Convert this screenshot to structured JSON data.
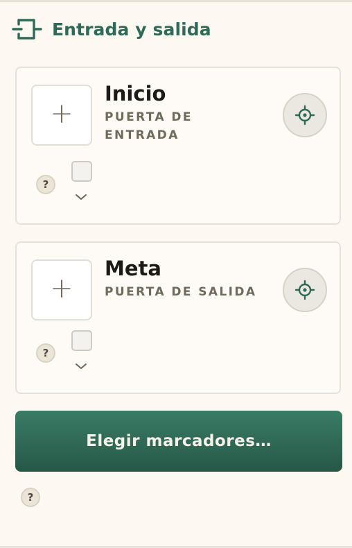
{
  "header": {
    "title": "Entrada y salida",
    "icon": "entrance-exit-icon",
    "accent_color": "#2e6a57"
  },
  "cards": [
    {
      "title": "Inicio",
      "subtitle": "PUERTA DE ENTRADA",
      "add_symbol": "+",
      "help_symbol": "?",
      "checked": false
    },
    {
      "title": "Meta",
      "subtitle": "PUERTA DE SALIDA",
      "add_symbol": "+",
      "help_symbol": "?",
      "checked": false
    }
  ],
  "primary_button": {
    "label": "Elegir marcadores…",
    "color": "#2f6b58"
  },
  "footer": {
    "help_symbol": "?"
  }
}
